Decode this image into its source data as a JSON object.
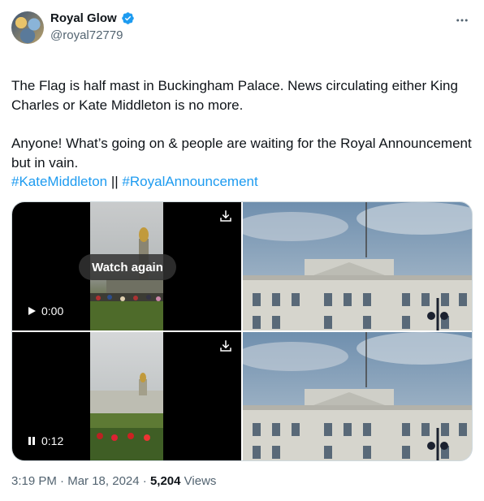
{
  "author": {
    "display_name": "Royal Glow",
    "handle": "@royal72779",
    "verified_color": "#1d9bf0"
  },
  "tweet": {
    "paragraph1": "The Flag is half mast in Buckingham Palace. News circulating either  King Charles or Kate Middleton is no more.",
    "paragraph2": "Anyone! What’s going on & people are waiting for the Royal Announcement but in vain.",
    "hashtag1": "#KateMiddleton",
    "separator": " || ",
    "hashtag2": "#RoyalAnnouncement"
  },
  "media": {
    "video1": {
      "overlay_label": "Watch again",
      "time": "0:00",
      "control_icon": "play-icon"
    },
    "video2": {
      "time": "0:12",
      "control_icon": "pause-icon"
    },
    "download_icon": "download-icon"
  },
  "meta": {
    "time": "3:19 PM",
    "dot": " · ",
    "date": "Mar 18, 2024",
    "views_count": "5,204",
    "views_label": " Views"
  },
  "colors": {
    "accent": "#1d9bf0",
    "text": "#0f1419",
    "secondary": "#536471"
  }
}
